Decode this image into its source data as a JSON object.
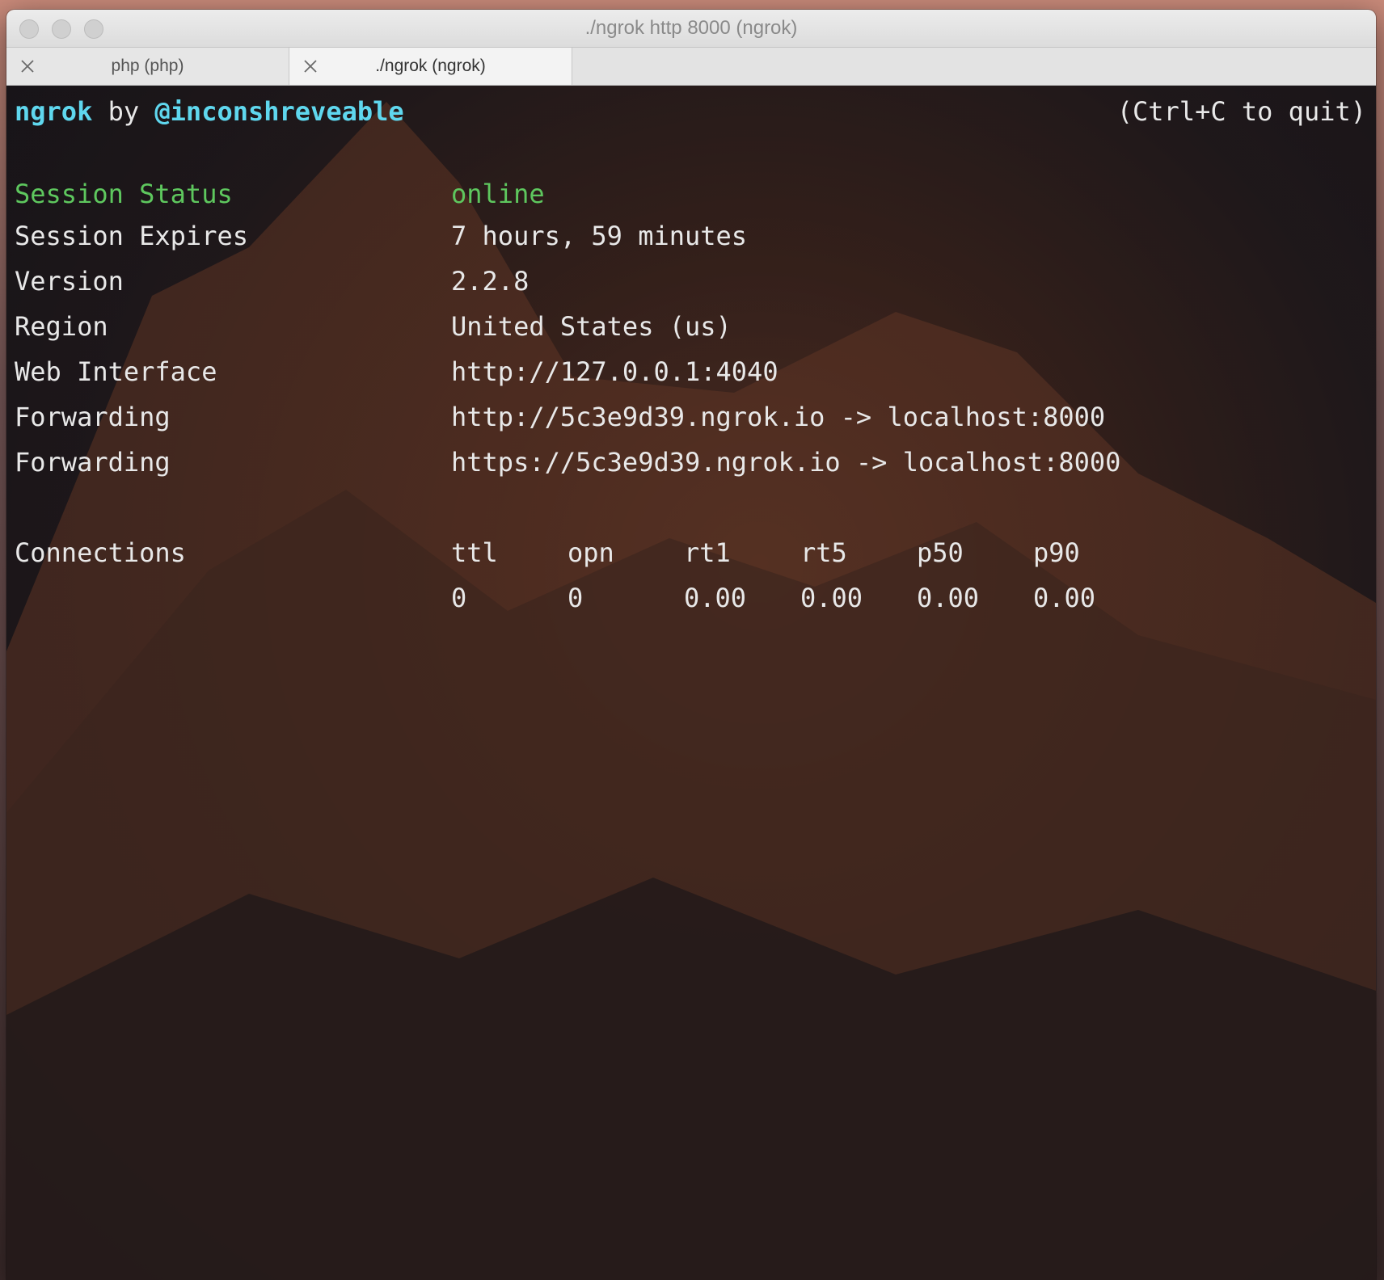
{
  "window": {
    "title": "./ngrok http 8000 (ngrok)",
    "tabs": [
      {
        "label": "php (php)",
        "active": false
      },
      {
        "label": "./ngrok (ngrok)",
        "active": true
      }
    ]
  },
  "terminal": {
    "header": {
      "app": "ngrok",
      "by": "by",
      "author": "@inconshreveable",
      "quit_hint": "(Ctrl+C to quit)"
    },
    "rows": [
      {
        "key": "Session Status",
        "value": "online"
      },
      {
        "key": "Session Expires",
        "value": "7 hours, 59 minutes"
      },
      {
        "key": "Version",
        "value": "2.2.8"
      },
      {
        "key": "Region",
        "value": "United States (us)"
      },
      {
        "key": "Web Interface",
        "value": "http://127.0.0.1:4040"
      },
      {
        "key": "Forwarding",
        "value": "http://5c3e9d39.ngrok.io -> localhost:8000"
      },
      {
        "key": "Forwarding",
        "value": "https://5c3e9d39.ngrok.io -> localhost:8000"
      }
    ],
    "connections": {
      "label": "Connections",
      "headers": [
        "ttl",
        "opn",
        "rt1",
        "rt5",
        "p50",
        "p90"
      ],
      "values": [
        "0",
        "0",
        "0.00",
        "0.00",
        "0.00",
        "0.00"
      ]
    }
  },
  "colors": {
    "accent_cyan": "#5fd7ee",
    "status_green": "#5ec75e",
    "text": "#e8e8e8"
  }
}
